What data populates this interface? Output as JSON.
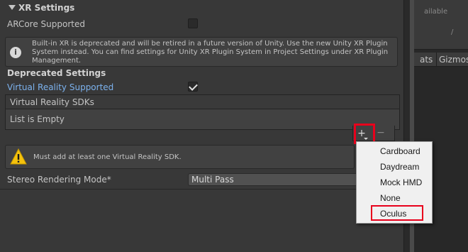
{
  "inspector": {
    "section_title": "XR Settings",
    "arcore_label": "ARCore Supported",
    "arcore_checked": false,
    "deprecation_help": "Built-in XR is deprecated and will be retired in a future version of Unity. Use the new Unity XR Plugin System instead. You can find settings for Unity XR Plugin System in Project Settings under XR Plugin Management.",
    "help_icon": "info-icon",
    "deprecated_heading": "Deprecated Settings",
    "vr_supported_label": "Virtual Reality Supported",
    "vr_supported_checked": true,
    "sdk_list_header": "Virtual Reality SDKs",
    "sdk_list_empty": "List is Empty",
    "add_button": "+",
    "remove_button": "−",
    "warning_text": "Must add at least one Virtual Reality SDK.",
    "warning_icon": "warning-icon",
    "stereo_label": "Stereo Rendering Mode*",
    "stereo_value": "Multi Pass"
  },
  "right_panel": {
    "available_text": "ailable",
    "slash_text": "/",
    "stats_tab": "ats",
    "gizmos_tab": "Gizmos"
  },
  "dropdown_menu": {
    "items": [
      "Cardboard",
      "Daydream",
      "Mock HMD",
      "None",
      "Oculus"
    ],
    "highlighted": "Oculus"
  },
  "colors": {
    "highlight_border": "#e8001c",
    "link_blue": "#7cb2ee",
    "background": "#383838"
  }
}
